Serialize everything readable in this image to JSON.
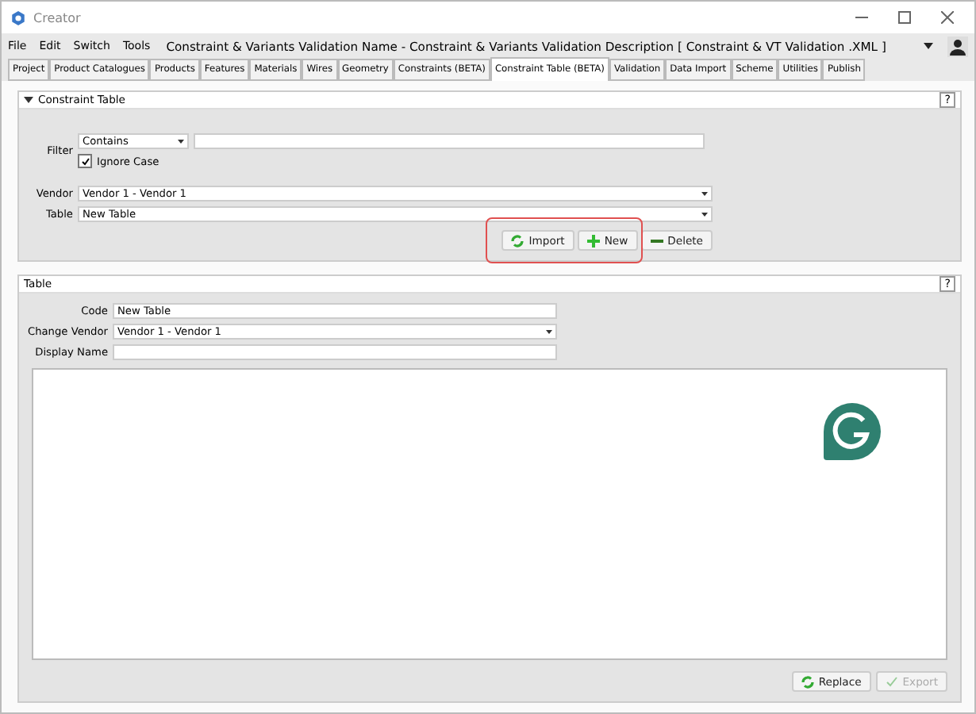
{
  "window": {
    "title": "Creator"
  },
  "menu": [
    "File",
    "Edit",
    "Switch",
    "Tools"
  ],
  "document_title": "Constraint & Variants Validation Name - Constraint & Variants Validation Description [ Constraint & VT Validation .XML ]",
  "tabs": [
    {
      "label": "Project",
      "selected": false
    },
    {
      "label": "Product Catalogues",
      "selected": false
    },
    {
      "label": "Products",
      "selected": false
    },
    {
      "label": "Features",
      "selected": false
    },
    {
      "label": "Materials",
      "selected": false
    },
    {
      "label": "Wires",
      "selected": false
    },
    {
      "label": "Geometry",
      "selected": false
    },
    {
      "label": "Constraints (BETA)",
      "selected": false
    },
    {
      "label": "Constraint Table (BETA)",
      "selected": true
    },
    {
      "label": "Validation",
      "selected": false
    },
    {
      "label": "Data Import",
      "selected": false
    },
    {
      "label": "Scheme",
      "selected": false
    },
    {
      "label": "Utilities",
      "selected": false
    },
    {
      "label": "Publish",
      "selected": false
    }
  ],
  "constraint_panel": {
    "title": "Constraint Table",
    "expanded": true,
    "help": "?",
    "filter": {
      "label": "Filter",
      "mode": "Contains",
      "ignore_case": {
        "label": "Ignore Case",
        "checked": true
      }
    },
    "vendor": {
      "label": "Vendor",
      "value": "Vendor 1 - Vendor 1"
    },
    "table": {
      "label": "Table",
      "value": "New Table"
    },
    "buttons": [
      {
        "kind": "import",
        "label": "Import",
        "disabled": false,
        "highlighted": true
      },
      {
        "kind": "new",
        "label": "New",
        "disabled": false,
        "highlighted": true
      },
      {
        "kind": "delete",
        "label": "Delete",
        "disabled": false,
        "highlighted": false
      }
    ]
  },
  "table_panel": {
    "title": "Table",
    "help": "?",
    "code": {
      "label": "Code",
      "value": "New Table"
    },
    "change_vendor": {
      "label": "Change Vendor",
      "value": "Vendor 1 - Vendor 1"
    },
    "display_name": {
      "label": "Display Name"
    },
    "buttons": [
      {
        "kind": "replace",
        "label": "Replace",
        "disabled": false
      },
      {
        "kind": "export",
        "label": "Export",
        "disabled": true
      }
    ]
  }
}
